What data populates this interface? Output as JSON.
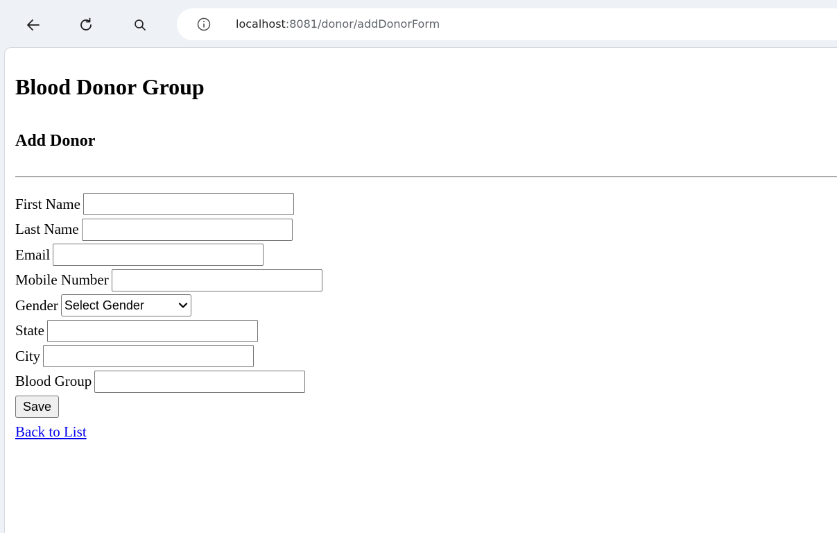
{
  "browser": {
    "url_host": "localhost",
    "url_path": ":8081/donor/addDonorForm"
  },
  "page": {
    "title": "Blood Donor Group",
    "subtitle": "Add Donor"
  },
  "form": {
    "first_name_label": "First Name",
    "last_name_label": "Last Name",
    "email_label": "Email",
    "mobile_label": "Mobile Number",
    "gender_label": "Gender",
    "gender_selected": "Select Gender",
    "state_label": "State",
    "city_label": "City",
    "blood_group_label": "Blood Group",
    "save_label": "Save",
    "back_link": "Back to List"
  },
  "icons": {
    "back": "arrow-left-icon",
    "reload": "reload-icon",
    "search": "search-icon",
    "info": "info-icon",
    "dropdown": "chevron-down-icon"
  }
}
